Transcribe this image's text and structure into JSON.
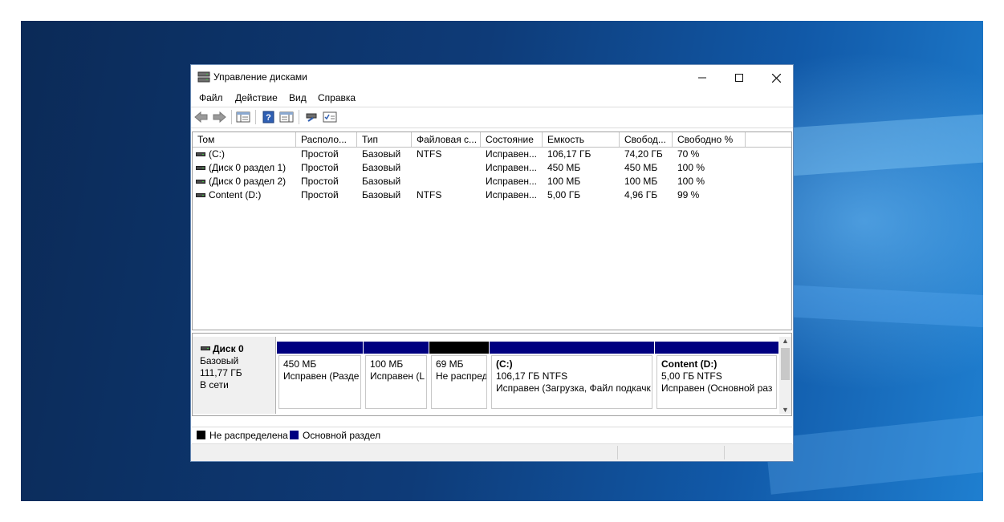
{
  "window": {
    "title": "Управление дисками"
  },
  "menu": [
    "Файл",
    "Действие",
    "Вид",
    "Справка"
  ],
  "toolbar_icons": [
    "back-arrow-icon",
    "forward-arrow-icon",
    "console-tree-icon",
    "help-icon",
    "properties-icon",
    "rescan-icon",
    "checklist-icon"
  ],
  "list": {
    "columns": [
      "Том",
      "Располо...",
      "Тип",
      "Файловая с...",
      "Состояние",
      "Емкость",
      "Свобод...",
      "Свободно %"
    ],
    "rows": [
      [
        "(C:)",
        "Простой",
        "Базовый",
        "NTFS",
        "Исправен...",
        "106,17 ГБ",
        "74,20 ГБ",
        "70 %"
      ],
      [
        "(Диск 0 раздел 1)",
        "Простой",
        "Базовый",
        "",
        "Исправен...",
        "450 МБ",
        "450 МБ",
        "100 %"
      ],
      [
        "(Диск 0 раздел 2)",
        "Простой",
        "Базовый",
        "",
        "Исправен...",
        "100 МБ",
        "100 МБ",
        "100 %"
      ],
      [
        "Content (D:)",
        "Простой",
        "Базовый",
        "NTFS",
        "Исправен...",
        "5,00 ГБ",
        "4,96 ГБ",
        "99 %"
      ]
    ]
  },
  "disk": {
    "name": "Диск 0",
    "type": "Базовый",
    "size": "111,77 ГБ",
    "status": "В сети",
    "partitions": [
      {
        "title": "",
        "size": "450 МБ",
        "status": "Исправен (Разде",
        "kind": "primary"
      },
      {
        "title": "",
        "size": "100 МБ",
        "status": "Исправен (L",
        "kind": "primary"
      },
      {
        "title": "",
        "size": "69 МБ",
        "status": "Не распреде",
        "kind": "unallocated"
      },
      {
        "title": "(C:)",
        "size": "106,17 ГБ NTFS",
        "status": "Исправен (Загрузка, Файл подкачк",
        "kind": "primary"
      },
      {
        "title": "Content  (D:)",
        "size": "5,00 ГБ NTFS",
        "status": "Исправен (Основной раз",
        "kind": "primary"
      }
    ]
  },
  "legend": [
    {
      "label": "Не распределена",
      "color": "#000000"
    },
    {
      "label": "Основной раздел",
      "color": "#000080"
    }
  ],
  "colors": {
    "primary": "#000080",
    "unallocated": "#000000",
    "window_border": "#6a8bb5"
  }
}
